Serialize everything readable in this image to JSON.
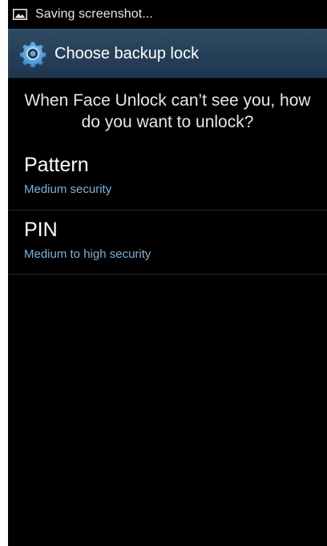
{
  "status_bar": {
    "icon": "image-icon",
    "text": "Saving screenshot..."
  },
  "action_bar": {
    "icon": "gear-icon",
    "title": "Choose backup lock"
  },
  "prompt": {
    "line1": "When Face Unlock can’t see you, how",
    "line2": "do you want to unlock?"
  },
  "options": [
    {
      "title": "Pattern",
      "subtitle": "Medium security"
    },
    {
      "title": "PIN",
      "subtitle": "Medium to high security"
    }
  ],
  "colors": {
    "background": "#000000",
    "action_bar": "#263e57",
    "subtitle": "#7fb0d8",
    "gear": "#5aa8e0"
  }
}
